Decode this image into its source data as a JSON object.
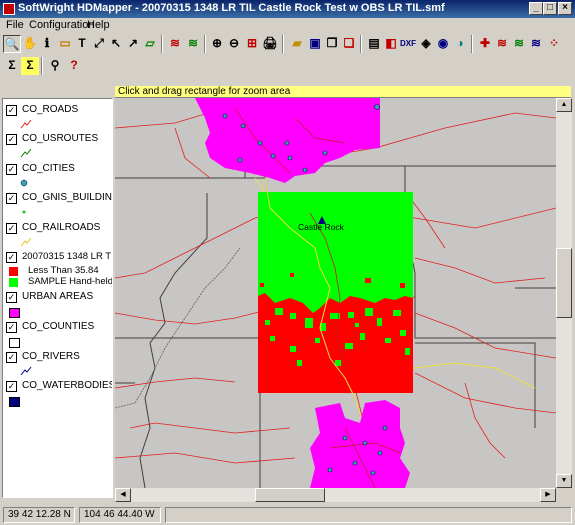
{
  "window": {
    "title": "SoftWright HDMapper - 20070315 1348 LR TIL Castle Rock Test w OBS LR TIL.smf",
    "minimize": "_",
    "maximize": "□",
    "close": "×"
  },
  "menu": [
    "File",
    "Configuration",
    "Help"
  ],
  "hint": "Click and drag rectangle for zoom area",
  "legend": {
    "layers": [
      {
        "name": "CO_ROADS",
        "checked": true
      },
      {
        "name": "CO_USROUTES",
        "checked": true
      },
      {
        "name": "CO_CITIES",
        "checked": true
      },
      {
        "name": "CO_GNIS_BUILDINGS",
        "checked": true
      },
      {
        "name": "CO_RAILROADS",
        "checked": true
      },
      {
        "name": "20070315 1348 LR TIL C",
        "checked": true
      },
      {
        "name": "URBAN AREAS",
        "checked": true
      },
      {
        "name": "CO_COUNTIES",
        "checked": true
      },
      {
        "name": "CO_RIVERS",
        "checked": true
      },
      {
        "name": "CO_WATERBODIES",
        "checked": true
      }
    ],
    "coverage_items": [
      {
        "label": "Less Than 35.84",
        "color": "#ff0000"
      },
      {
        "label": "SAMPLE Hand-held",
        "color": "#00ff00"
      }
    ]
  },
  "map": {
    "city_label": "Castle Rock",
    "colors": {
      "background": "#c8c6c4",
      "urban": "#ff00ff",
      "coverage_good": "#00ff00",
      "coverage_bad": "#ff0000",
      "roads": "#e02020",
      "counties": "#404040",
      "railroad": "#e0e040",
      "cities": "#3aa0a0"
    }
  },
  "status": {
    "latitude": "39 42 12.28 N",
    "longitude": "104 46 44.40 W"
  },
  "check_mark": "✓"
}
